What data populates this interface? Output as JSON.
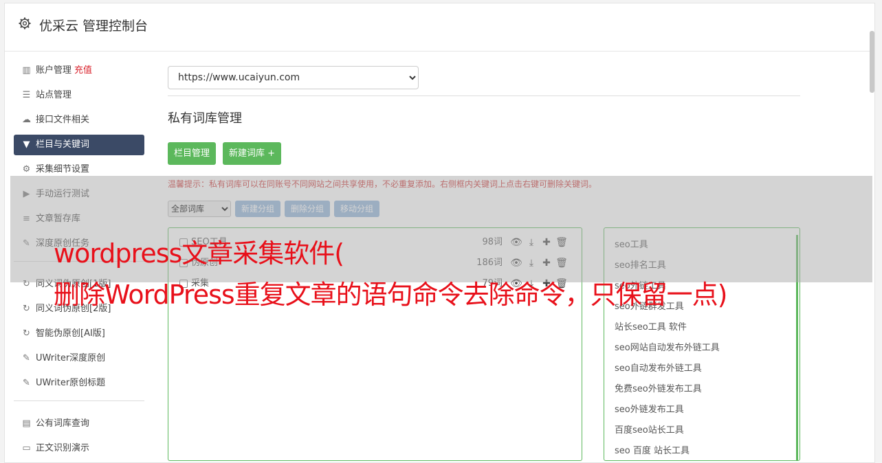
{
  "header": {
    "title": "优采云 管理控制台",
    "icon": "gear-icon"
  },
  "sidebar": {
    "group1": [
      {
        "label": "账户管理",
        "extra": "充值",
        "icon": "bar-chart-icon"
      },
      {
        "label": "站点管理",
        "icon": "server-icon"
      },
      {
        "label": "接口文件相关",
        "icon": "cloud-upload-icon"
      },
      {
        "label": "栏目与关键词",
        "icon": "filter-icon",
        "active": true
      },
      {
        "label": "采集细节设置",
        "icon": "gears-icon"
      },
      {
        "label": "手动运行测试",
        "icon": "play-icon"
      },
      {
        "label": "文章暂存库",
        "icon": "database-icon"
      },
      {
        "label": "深度原创任务",
        "icon": "edit-icon"
      }
    ],
    "group2": [
      {
        "label": "同义词伪原创[1版]",
        "icon": "refresh-icon"
      },
      {
        "label": "同义词伪原创[2版]",
        "icon": "refresh-icon"
      },
      {
        "label": "智能伪原创[AI版]",
        "icon": "refresh-icon"
      },
      {
        "label": "UWriter深度原创",
        "icon": "edit-icon"
      },
      {
        "label": "UWriter原创标题",
        "icon": "edit-icon"
      }
    ],
    "group3": [
      {
        "label": "公有词库查询",
        "icon": "book-icon"
      },
      {
        "label": "正文识别演示",
        "icon": "monitor-icon"
      }
    ]
  },
  "main": {
    "site_select": "https://www.ucaiyun.com",
    "section_title": "私有词库管理",
    "btn_columns": "栏目管理",
    "btn_new_lib": "新建词库 +",
    "tip": "温馨提示：私有词库可以在同账号不同网站之间共享使用，不必重复添加。右侧框内关键词上点击右键可删除关键词。",
    "filter_select": "全部词库",
    "btn_new_group": "新建分组",
    "btn_delete_group": "删除分组",
    "btn_move_group": "移动分组"
  },
  "libraries": [
    {
      "name": "SEO工具",
      "count": "98词"
    },
    {
      "name": "伪原创",
      "count": "186词"
    },
    {
      "name": "采集",
      "count": "79词"
    }
  ],
  "keywords": [
    "seo工具",
    "seo排名工具",
    "seo外链工具",
    "seo外链群发工具",
    "站长seo工具 软件",
    "seo网站自动发布外链工具",
    "seo自动发布外链工具",
    "免费seo外链发布工具",
    "seo外链发布工具",
    "百度seo站长工具",
    "seo 百度 站长工具"
  ],
  "overlay": {
    "line1": "wordpress文章采集软件(",
    "line2": "删除WordPress重复文章的语句命令去除命令，只保留一点)"
  },
  "colors": {
    "green": "#5cb85c",
    "active_nav": "#3b4a66",
    "overlay_text": "#e8101a"
  }
}
